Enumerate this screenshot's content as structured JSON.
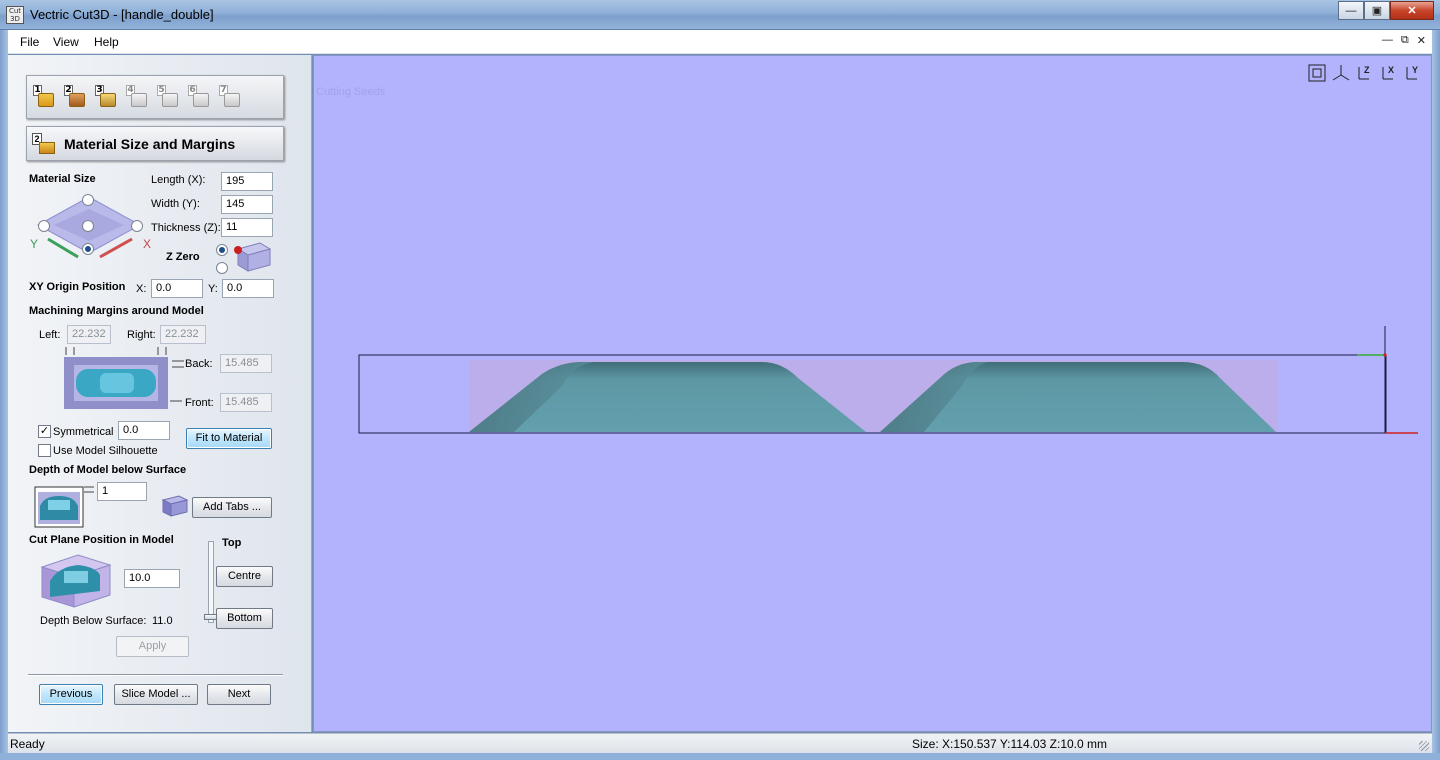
{
  "window": {
    "title": "Vectric Cut3D - [handle_double]",
    "app_icon_label": "Cut 3D"
  },
  "menu": {
    "items": [
      "File",
      "View",
      "Help"
    ]
  },
  "toolbar": {
    "steps": [
      "1",
      "2",
      "3",
      "4",
      "5",
      "6",
      "7"
    ]
  },
  "section": {
    "number": "2",
    "title": "Material Size and Margins"
  },
  "material": {
    "heading": "Material Size",
    "length_label": "Length (X):",
    "length": "195",
    "width_label": "Width (Y):",
    "width": "145",
    "thickness_label": "Thickness (Z):",
    "thickness": "11",
    "zzero_label": "Z Zero",
    "axis_x": "X",
    "axis_y": "Y"
  },
  "xy_origin": {
    "label": "XY Origin Position",
    "x_label": "X:",
    "x": "0.0",
    "y_label": "Y:",
    "y": "0.0"
  },
  "margins": {
    "heading": "Machining Margins around Model",
    "left_label": "Left:",
    "left": "22.232",
    "right_label": "Right:",
    "right": "22.232",
    "back_label": "Back:",
    "back": "15.485",
    "front_label": "Front:",
    "front": "15.485",
    "symmetrical_label": "Symmetrical",
    "symmetrical_checked": true,
    "symmetrical_value": "0.0",
    "silhouette_label": "Use Model Silhouette",
    "silhouette_checked": false,
    "fit_button": "Fit to Material"
  },
  "depth": {
    "heading": "Depth of Model below Surface",
    "value": "1",
    "add_tabs": "Add Tabs ..."
  },
  "cutplane": {
    "heading": "Cut Plane Position in Model",
    "value": "10.0",
    "top_label": "Top",
    "centre": "Centre",
    "bottom": "Bottom",
    "depth_label": "Depth Below Surface:",
    "depth_value": "11.0",
    "apply": "Apply"
  },
  "nav": {
    "previous": "Previous",
    "slice": "Slice Model ...",
    "next": "Next"
  },
  "viewport": {
    "faded_text": "Cutting Seeds",
    "view_icons": [
      "fit-all",
      "iso",
      "Z",
      "X",
      "Y"
    ]
  },
  "status": {
    "left": "Ready",
    "right": "Size: X:150.537 Y:114.03 Z:10.0 mm"
  },
  "colors": {
    "viewport_bg": "#b3b3fd",
    "model": "#5e98a5",
    "material_area": "#bcaeea"
  }
}
